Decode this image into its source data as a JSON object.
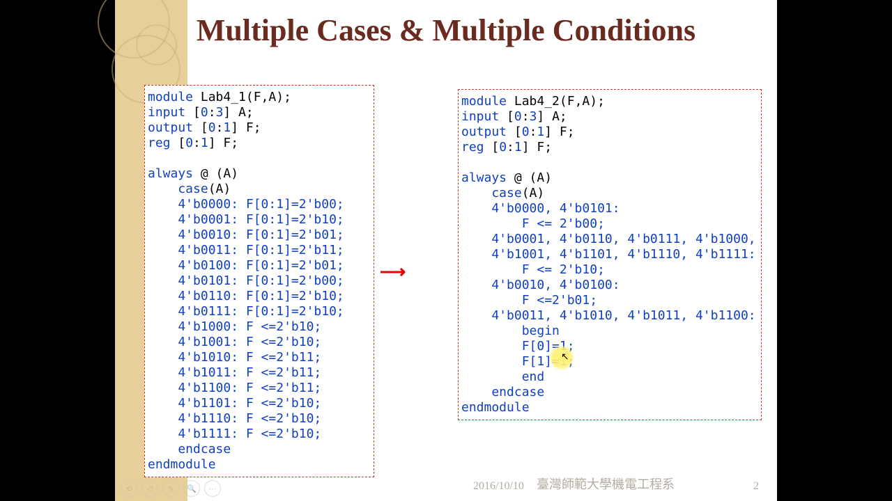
{
  "title": "Multiple Cases & Multiple Conditions",
  "footer": {
    "date": "2016/10/10",
    "org": "臺灣師範大學機電工程系",
    "page": "2"
  },
  "code_left": {
    "l1": {
      "a": "module",
      "b": " Lab4_1(F,A);"
    },
    "l2": {
      "a": "input",
      "b": " [",
      "c": "0",
      "d": ":",
      "e": "3",
      "f": "] A;"
    },
    "l3": {
      "a": "output",
      "b": " [",
      "c": "0",
      "d": ":",
      "e": "1",
      "f": "] F;"
    },
    "l4": {
      "a": "reg",
      "b": " [",
      "c": "0",
      "d": ":",
      "e": "1",
      "f": "] F;"
    },
    "blank": " ",
    "l5": {
      "a": "always",
      "b": " @ (A)"
    },
    "l6": {
      "a": "    case",
      "b": "(A)"
    },
    "c": [
      "    4'b0000: F[0:1]=2'b00;",
      "    4'b0001: F[0:1]=2'b10;",
      "    4'b0010: F[0:1]=2'b01;",
      "    4'b0011: F[0:1]=2'b11;",
      "    4'b0100: F[0:1]=2'b01;",
      "    4'b0101: F[0:1]=2'b00;",
      "    4'b0110: F[0:1]=2'b10;",
      "    4'b0111: F[0:1]=2'b10;",
      "    4'b1000: F <=2'b10;",
      "    4'b1001: F <=2'b10;",
      "    4'b1010: F <=2'b11;",
      "    4'b1011: F <=2'b11;",
      "    4'b1100: F <=2'b11;",
      "    4'b1101: F <=2'b10;",
      "    4'b1110: F <=2'b10;",
      "    4'b1111: F <=2'b10;"
    ],
    "l7": "    endcase",
    "l8": "endmodule"
  },
  "code_right": {
    "l1": {
      "a": "module",
      "b": " Lab4_2(F,A);"
    },
    "l2": {
      "a": "input",
      "b": " [",
      "c": "0",
      "d": ":",
      "e": "3",
      "f": "] A;"
    },
    "l3": {
      "a": "output",
      "b": " [",
      "c": "0",
      "d": ":",
      "e": "1",
      "f": "] F;"
    },
    "l4": {
      "a": "reg",
      "b": " [",
      "c": "0",
      "d": ":",
      "e": "1",
      "f": "] F;"
    },
    "blank": " ",
    "l5": {
      "a": "always",
      "b": " @ (A)"
    },
    "l6": {
      "a": "    case",
      "b": "(A)"
    },
    "g1a": "    4'b0000, 4'b0101:",
    "g1b": "        F <= 2'b00;",
    "g2a": "    4'b0001, 4'b0110, 4'b0111, 4'b1000,",
    "g2b": "    4'b1001, 4'b1101, 4'b1110, 4'b1111:",
    "g2c": "        F <= 2'b10;",
    "g3a": "    4'b0010, 4'b0100:",
    "g3b": "        F <=2'b01;",
    "g4a": "    4'b0011, 4'b1010, 4'b1011, 4'b1100:",
    "g4b": {
      "a": "        ",
      "b": "begin"
    },
    "g4c": "        F[0]=1;",
    "g4d": "        F[1]=1;",
    "g4e": {
      "a": "        ",
      "b": "end"
    },
    "l7": "    endcase",
    "l8": "endmodule"
  },
  "arrow": "⟶",
  "nav": [
    "⟲",
    "◁",
    "✎",
    "🔍",
    "⋯"
  ]
}
